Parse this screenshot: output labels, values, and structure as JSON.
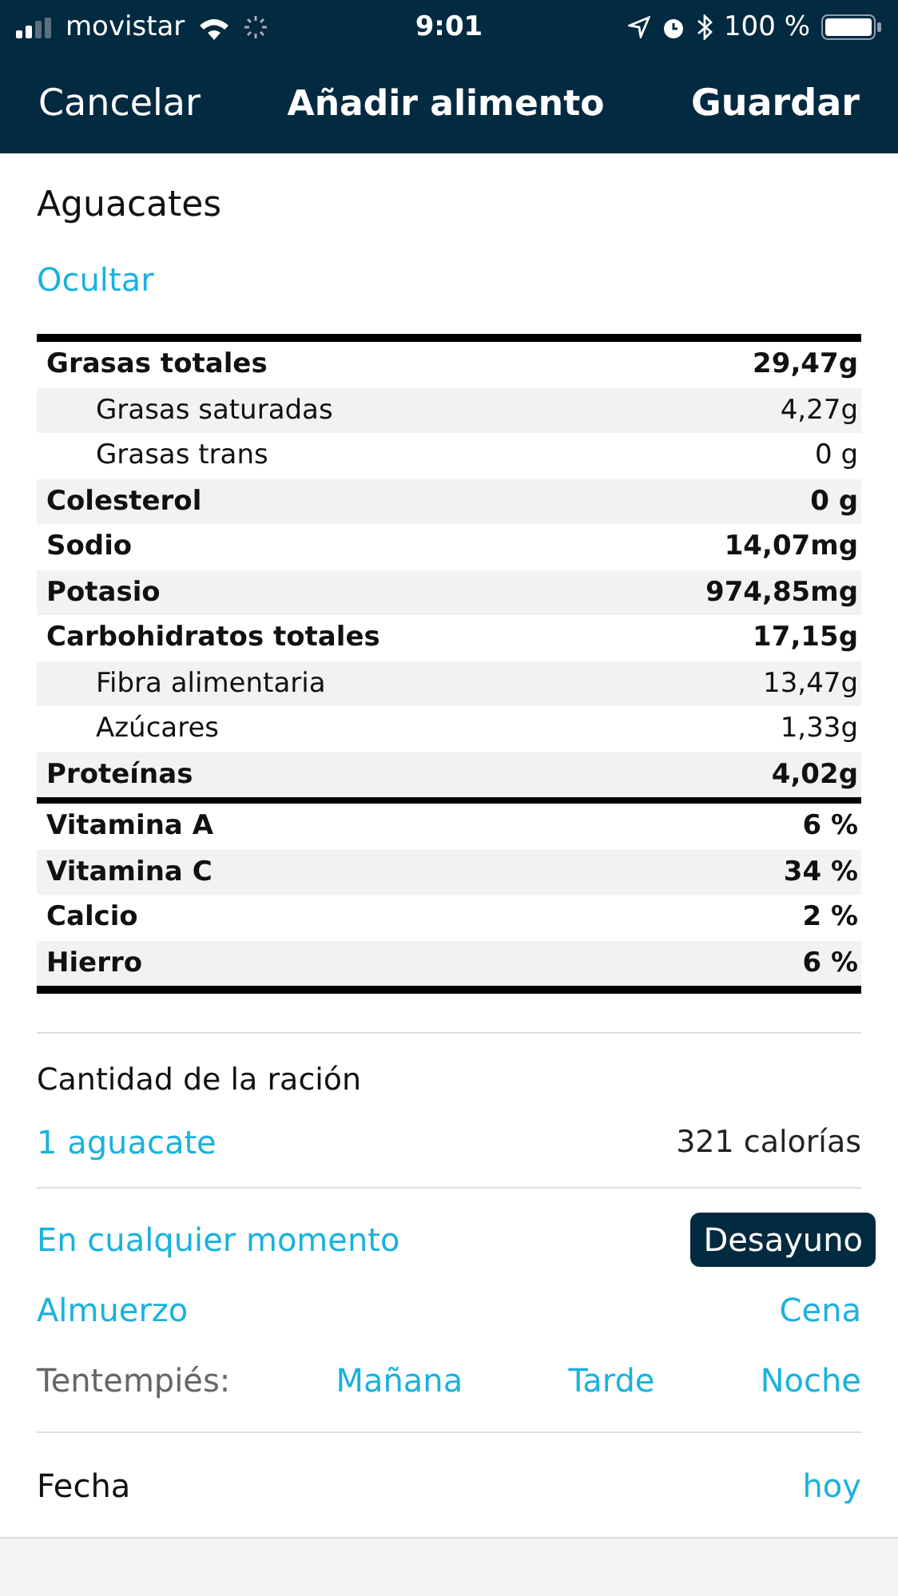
{
  "status_bar": {
    "carrier": "movistar",
    "time": "9:01",
    "battery": "100 %"
  },
  "nav": {
    "left": "Cancelar",
    "title": "Añadir alimento",
    "right": "Guardar"
  },
  "food": {
    "name": "Aguacates",
    "toggle": "Ocultar"
  },
  "nutrition": [
    [
      {
        "name": "Grasas totales",
        "value": "29,47g",
        "kind": "main"
      },
      {
        "name": "Grasas saturadas",
        "value": "4,27g",
        "kind": "sub"
      },
      {
        "name": "Grasas trans",
        "value": "0 g",
        "kind": "sub"
      },
      {
        "name": "Colesterol",
        "value": "0 g",
        "kind": "main"
      },
      {
        "name": "Sodio",
        "value": "14,07mg",
        "kind": "main"
      },
      {
        "name": "Potasio",
        "value": "974,85mg",
        "kind": "main"
      },
      {
        "name": "Carbohidratos totales",
        "value": "17,15g",
        "kind": "main"
      },
      {
        "name": "Fibra alimentaria",
        "value": "13,47g",
        "kind": "sub"
      },
      {
        "name": "Azúcares",
        "value": "1,33g",
        "kind": "sub"
      },
      {
        "name": "Proteínas",
        "value": "4,02g",
        "kind": "main"
      }
    ],
    [
      {
        "name": "Vitamina A",
        "value": "6 %",
        "kind": "main"
      },
      {
        "name": "Vitamina C",
        "value": "34 %",
        "kind": "main"
      },
      {
        "name": "Calcio",
        "value": "2 %",
        "kind": "main"
      },
      {
        "name": "Hierro",
        "value": "6 %",
        "kind": "main"
      }
    ]
  ],
  "serving": {
    "label": "Cantidad de la ración",
    "amount": "1 aguacate",
    "calories": "321 calorías"
  },
  "meals": [
    [
      {
        "label": "En cualquier momento",
        "selected": false
      },
      {
        "label": "Desayuno",
        "selected": true
      }
    ],
    [
      {
        "label": "Almuerzo",
        "selected": false
      },
      {
        "label": "Cena",
        "selected": false
      }
    ]
  ],
  "snacks": {
    "label": "Tentempiés:",
    "items": [
      {
        "label": "Mañana",
        "selected": false
      },
      {
        "label": "Tarde",
        "selected": false
      },
      {
        "label": "Noche",
        "selected": false
      }
    ]
  },
  "date": {
    "label": "Fecha",
    "value": "hoy"
  }
}
